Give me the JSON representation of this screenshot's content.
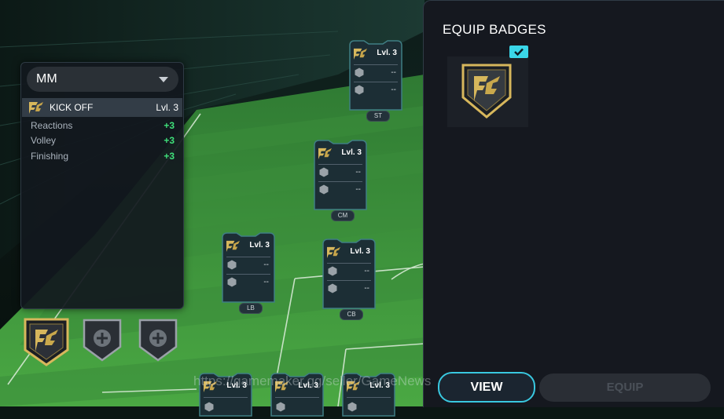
{
  "info_panel": {
    "dropdown_value": "MM",
    "badge": {
      "icon": "fc-badge-icon",
      "name": "KICK OFF",
      "level": "Lvl. 3"
    },
    "stats": [
      {
        "label": "Reactions",
        "value": "+3"
      },
      {
        "label": "Volley",
        "value": "+3"
      },
      {
        "label": "Finishing",
        "value": "+3"
      }
    ]
  },
  "badge_slots": [
    {
      "state": "equipped",
      "icon": "fc-badge-icon"
    },
    {
      "state": "empty",
      "icon": "plus-icon"
    },
    {
      "state": "empty",
      "icon": "plus-icon"
    }
  ],
  "players": [
    {
      "position": "ST",
      "level": "Lvl. 3",
      "slots": [
        "--",
        "--"
      ]
    },
    {
      "position": "CM",
      "level": "Lvl. 3",
      "slots": [
        "--",
        "--"
      ]
    },
    {
      "position": "LB",
      "level": "Lvl. 3",
      "slots": [
        "--",
        "--"
      ]
    },
    {
      "position": "CB",
      "level": "Lvl. 3",
      "slots": [
        "--",
        "--"
      ]
    },
    {
      "position": "",
      "level": "Lvl. 3",
      "slots": []
    },
    {
      "position": "",
      "level": "Lvl. 3",
      "slots": []
    },
    {
      "position": "",
      "level": "Lvl. 3",
      "slots": []
    }
  ],
  "equip_panel": {
    "title": "EQUIP BADGES",
    "selected_badge_icon": "fc-badge-icon",
    "selected_check_icon": "checkmark-icon",
    "view_label": "VIEW",
    "equip_label": "EQUIP"
  },
  "watermark": "https://gamemaker.gg/seller/GameNews",
  "colors": {
    "accent_cyan": "#39c8e0",
    "stat_green": "#3fe07a",
    "badge_gold": "#d7b75c",
    "pitch_green": "#3f9a3a"
  }
}
